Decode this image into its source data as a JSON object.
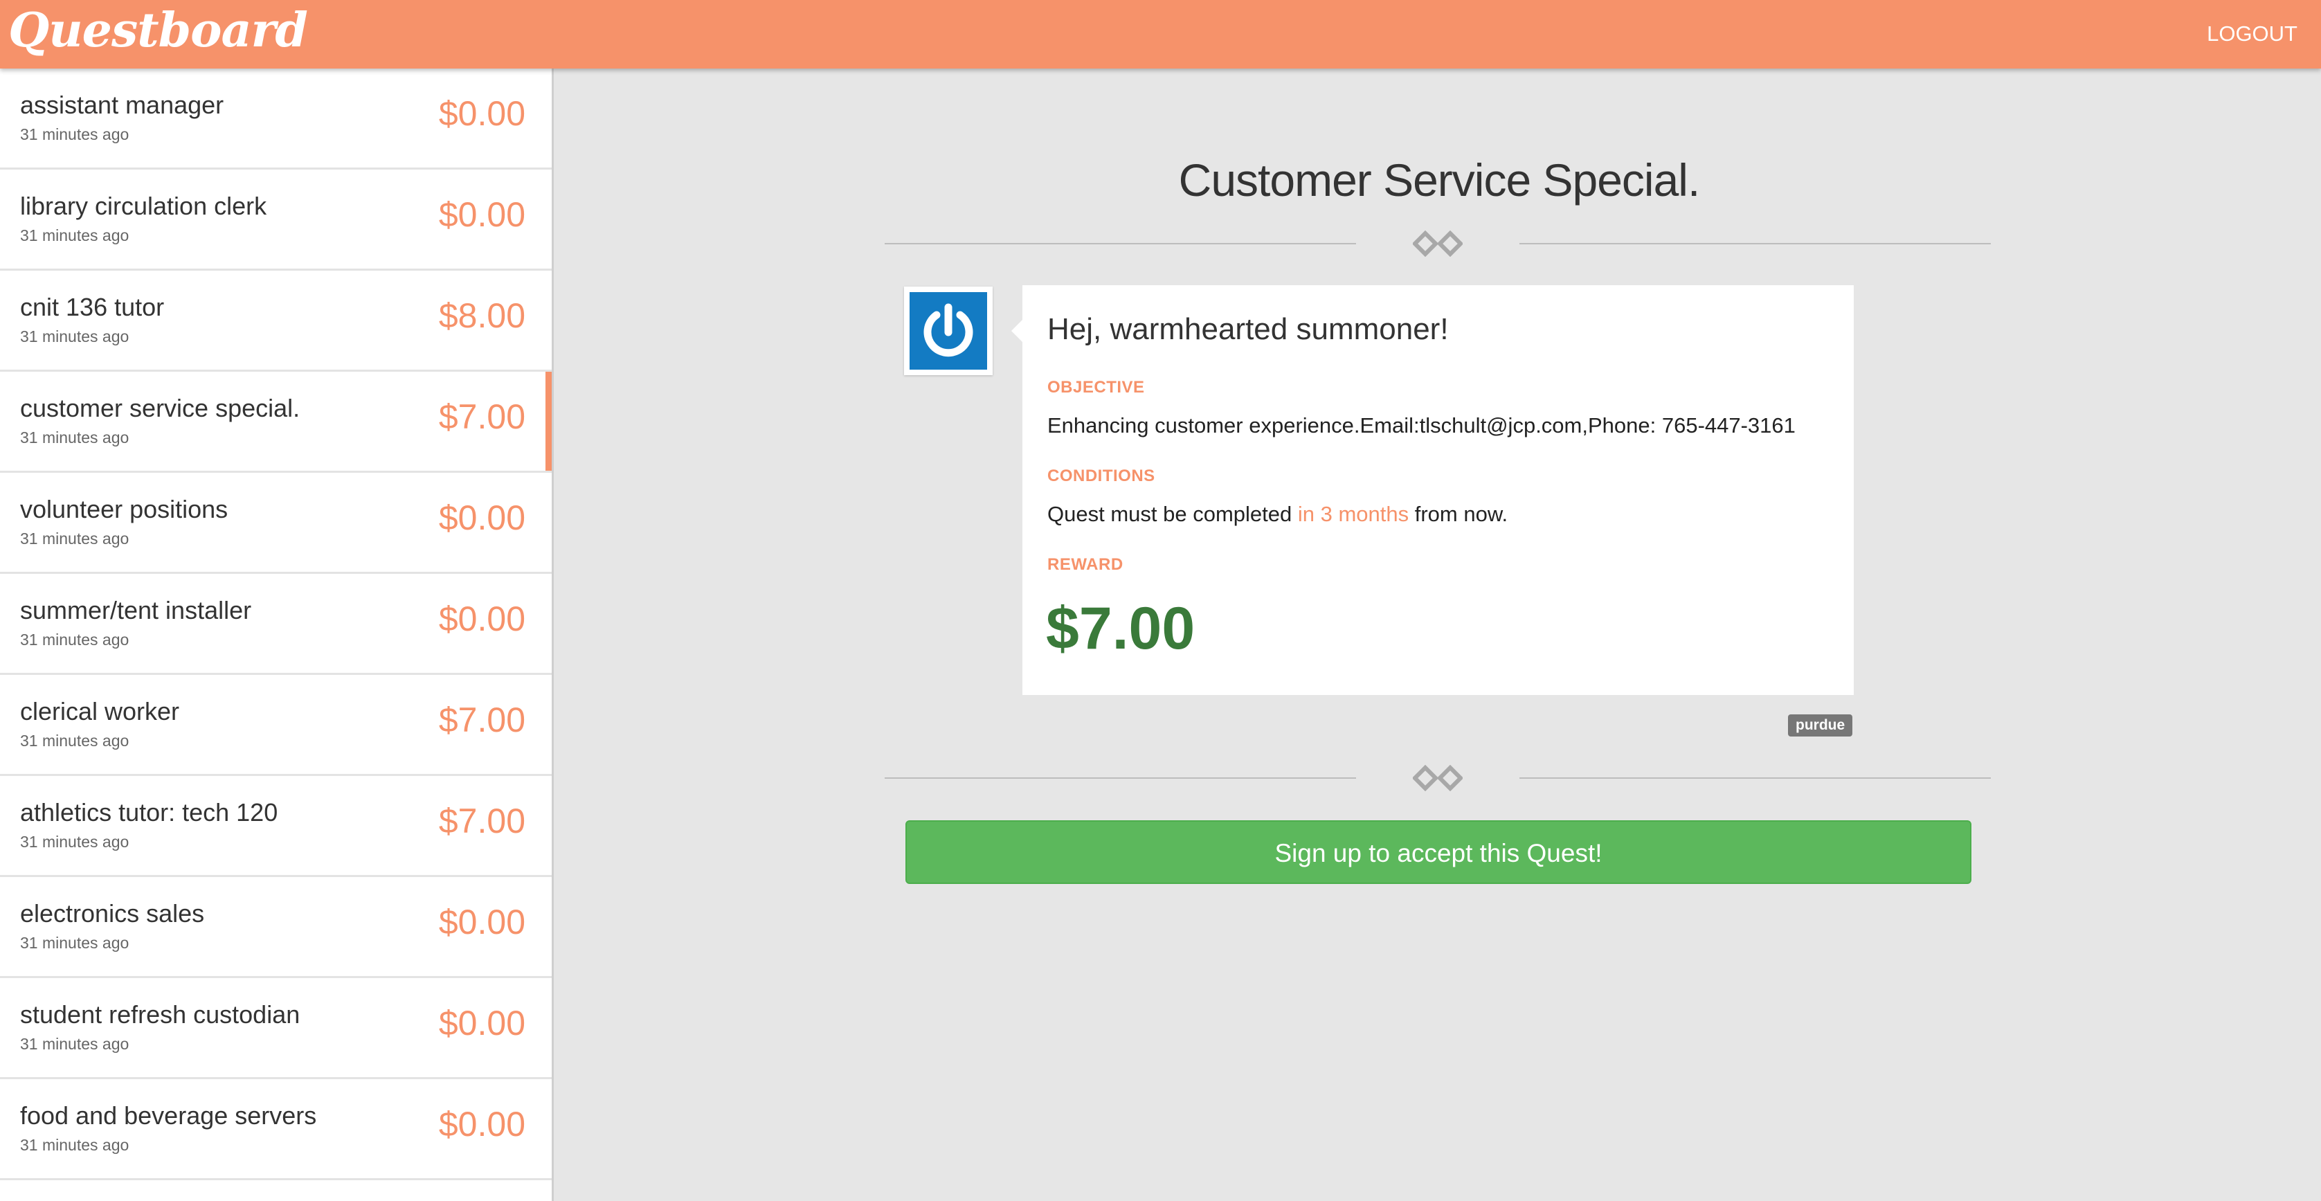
{
  "header": {
    "logo": "Questboard",
    "logout_label": "LOGOUT"
  },
  "sidebar": {
    "items": [
      {
        "title": "assistant manager",
        "time": "31 minutes ago",
        "amount": "$0.00"
      },
      {
        "title": "library circulation clerk",
        "time": "31 minutes ago",
        "amount": "$0.00"
      },
      {
        "title": "cnit 136 tutor",
        "time": "31 minutes ago",
        "amount": "$8.00"
      },
      {
        "title": "customer service special.",
        "time": "31 minutes ago",
        "amount": "$7.00",
        "active": true
      },
      {
        "title": "volunteer positions",
        "time": "31 minutes ago",
        "amount": "$0.00"
      },
      {
        "title": "summer/tent installer",
        "time": "31 minutes ago",
        "amount": "$0.00"
      },
      {
        "title": "clerical worker",
        "time": "31 minutes ago",
        "amount": "$7.00"
      },
      {
        "title": "athletics tutor: tech 120",
        "time": "31 minutes ago",
        "amount": "$7.00"
      },
      {
        "title": "electronics sales",
        "time": "31 minutes ago",
        "amount": "$0.00"
      },
      {
        "title": "student refresh custodian",
        "time": "31 minutes ago",
        "amount": "$0.00"
      },
      {
        "title": "food and beverage servers",
        "time": "31 minutes ago",
        "amount": "$0.00"
      }
    ]
  },
  "quest": {
    "title": "Customer Service Special.",
    "greeting": "Hej, warmhearted summoner!",
    "objective_label": "OBJECTIVE",
    "objective_text": "Enhancing customer experience.Email:tlschult@jcp.com,Phone: 765-447-3161",
    "conditions_label": "CONDITIONS",
    "conditions_prefix": "Quest must be completed ",
    "conditions_highlight": "in 3 months",
    "conditions_suffix": " from now.",
    "reward_label": "REWARD",
    "reward_value": "$7.00",
    "tag": "purdue",
    "cta_label": "Sign up to accept this Quest!"
  },
  "colors": {
    "brand": "#f6926a",
    "reward": "#3a7a3a",
    "cta": "#5cb85c",
    "avatar": "#137bc3"
  },
  "icons": {
    "avatar": "power-icon",
    "divider": "diamond-divider-icon"
  }
}
